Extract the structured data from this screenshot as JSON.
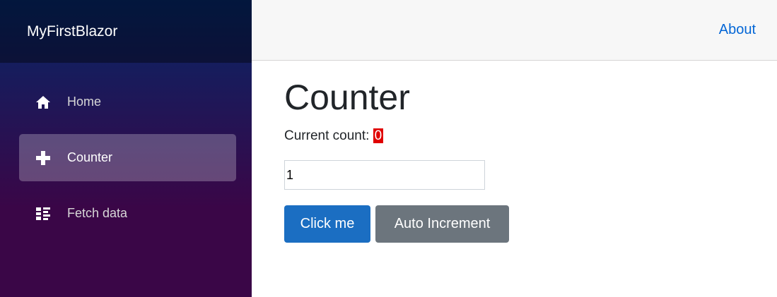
{
  "app": {
    "brand": "MyFirstBlazor"
  },
  "nav": {
    "items": [
      {
        "label": "Home",
        "icon": "home-icon",
        "active": false
      },
      {
        "label": "Counter",
        "icon": "plus-icon",
        "active": true
      },
      {
        "label": "Fetch data",
        "icon": "list-icon",
        "active": false
      }
    ]
  },
  "topbar": {
    "about_label": "About"
  },
  "page": {
    "title": "Counter",
    "count_label": "Current count: ",
    "count_value": "0",
    "increment_input_value": "1",
    "click_button_label": "Click me",
    "auto_button_label": "Auto Increment"
  },
  "colors": {
    "primary": "#1b6ec2",
    "secondary": "#6c757d",
    "link": "#0366d6",
    "count_highlight": "#e00000"
  }
}
